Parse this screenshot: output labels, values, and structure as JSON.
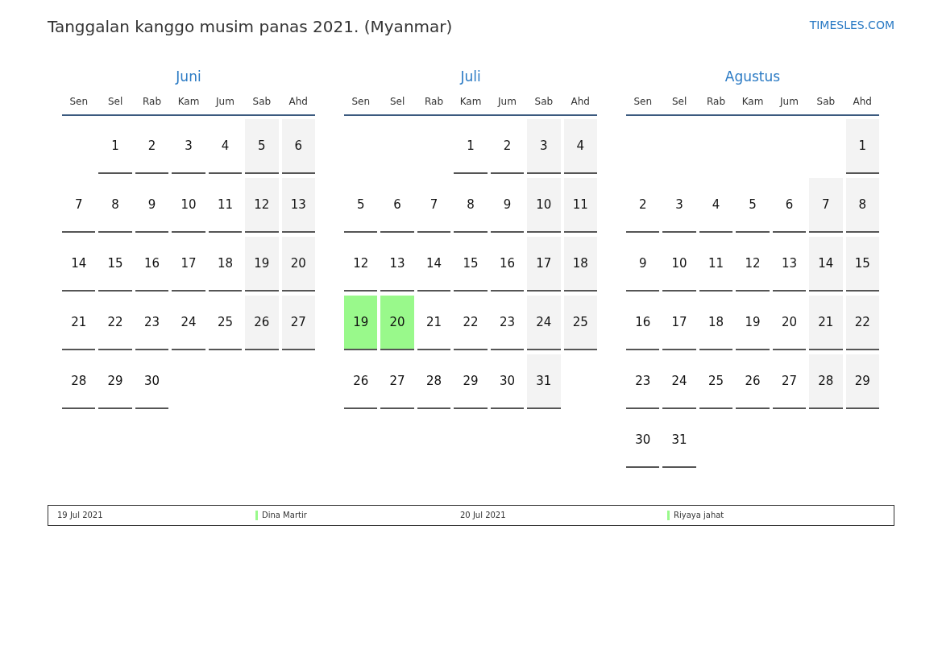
{
  "header": {
    "title": "Tanggalan kanggo musim panas 2021. (Myanmar)",
    "site_link": "TIMESLES.COM"
  },
  "months": [
    {
      "name": "Juni",
      "weekdays": [
        "Sen",
        "Sel",
        "Rab",
        "Kam",
        "Jum",
        "Sab",
        "Ahd"
      ],
      "days": [
        {
          "kind": "empty"
        },
        {
          "kind": "date",
          "day": "1",
          "weekend": false,
          "holiday": false
        },
        {
          "kind": "date",
          "day": "2",
          "weekend": false,
          "holiday": false
        },
        {
          "kind": "date",
          "day": "3",
          "weekend": false,
          "holiday": false
        },
        {
          "kind": "date",
          "day": "4",
          "weekend": false,
          "holiday": false
        },
        {
          "kind": "date",
          "day": "5",
          "weekend": true,
          "holiday": false
        },
        {
          "kind": "date",
          "day": "6",
          "weekend": true,
          "holiday": false
        },
        {
          "kind": "date",
          "day": "7",
          "weekend": false,
          "holiday": false
        },
        {
          "kind": "date",
          "day": "8",
          "weekend": false,
          "holiday": false
        },
        {
          "kind": "date",
          "day": "9",
          "weekend": false,
          "holiday": false
        },
        {
          "kind": "date",
          "day": "10",
          "weekend": false,
          "holiday": false
        },
        {
          "kind": "date",
          "day": "11",
          "weekend": false,
          "holiday": false
        },
        {
          "kind": "date",
          "day": "12",
          "weekend": true,
          "holiday": false
        },
        {
          "kind": "date",
          "day": "13",
          "weekend": true,
          "holiday": false
        },
        {
          "kind": "date",
          "day": "14",
          "weekend": false,
          "holiday": false
        },
        {
          "kind": "date",
          "day": "15",
          "weekend": false,
          "holiday": false
        },
        {
          "kind": "date",
          "day": "16",
          "weekend": false,
          "holiday": false
        },
        {
          "kind": "date",
          "day": "17",
          "weekend": false,
          "holiday": false
        },
        {
          "kind": "date",
          "day": "18",
          "weekend": false,
          "holiday": false
        },
        {
          "kind": "date",
          "day": "19",
          "weekend": true,
          "holiday": false
        },
        {
          "kind": "date",
          "day": "20",
          "weekend": true,
          "holiday": false
        },
        {
          "kind": "date",
          "day": "21",
          "weekend": false,
          "holiday": false
        },
        {
          "kind": "date",
          "day": "22",
          "weekend": false,
          "holiday": false
        },
        {
          "kind": "date",
          "day": "23",
          "weekend": false,
          "holiday": false
        },
        {
          "kind": "date",
          "day": "24",
          "weekend": false,
          "holiday": false
        },
        {
          "kind": "date",
          "day": "25",
          "weekend": false,
          "holiday": false
        },
        {
          "kind": "date",
          "day": "26",
          "weekend": true,
          "holiday": false
        },
        {
          "kind": "date",
          "day": "27",
          "weekend": true,
          "holiday": false
        },
        {
          "kind": "date",
          "day": "28",
          "weekend": false,
          "holiday": false
        },
        {
          "kind": "date",
          "day": "29",
          "weekend": false,
          "holiday": false
        },
        {
          "kind": "date",
          "day": "30",
          "weekend": false,
          "holiday": false
        }
      ]
    },
    {
      "name": "Juli",
      "weekdays": [
        "Sen",
        "Sel",
        "Rab",
        "Kam",
        "Jum",
        "Sab",
        "Ahd"
      ],
      "days": [
        {
          "kind": "empty"
        },
        {
          "kind": "empty"
        },
        {
          "kind": "empty"
        },
        {
          "kind": "date",
          "day": "1",
          "weekend": false,
          "holiday": false
        },
        {
          "kind": "date",
          "day": "2",
          "weekend": false,
          "holiday": false
        },
        {
          "kind": "date",
          "day": "3",
          "weekend": true,
          "holiday": false
        },
        {
          "kind": "date",
          "day": "4",
          "weekend": true,
          "holiday": false
        },
        {
          "kind": "date",
          "day": "5",
          "weekend": false,
          "holiday": false
        },
        {
          "kind": "date",
          "day": "6",
          "weekend": false,
          "holiday": false
        },
        {
          "kind": "date",
          "day": "7",
          "weekend": false,
          "holiday": false
        },
        {
          "kind": "date",
          "day": "8",
          "weekend": false,
          "holiday": false
        },
        {
          "kind": "date",
          "day": "9",
          "weekend": false,
          "holiday": false
        },
        {
          "kind": "date",
          "day": "10",
          "weekend": true,
          "holiday": false
        },
        {
          "kind": "date",
          "day": "11",
          "weekend": true,
          "holiday": false
        },
        {
          "kind": "date",
          "day": "12",
          "weekend": false,
          "holiday": false
        },
        {
          "kind": "date",
          "day": "13",
          "weekend": false,
          "holiday": false
        },
        {
          "kind": "date",
          "day": "14",
          "weekend": false,
          "holiday": false
        },
        {
          "kind": "date",
          "day": "15",
          "weekend": false,
          "holiday": false
        },
        {
          "kind": "date",
          "day": "16",
          "weekend": false,
          "holiday": false
        },
        {
          "kind": "date",
          "day": "17",
          "weekend": true,
          "holiday": false
        },
        {
          "kind": "date",
          "day": "18",
          "weekend": true,
          "holiday": false
        },
        {
          "kind": "date",
          "day": "19",
          "weekend": false,
          "holiday": true
        },
        {
          "kind": "date",
          "day": "20",
          "weekend": false,
          "holiday": true
        },
        {
          "kind": "date",
          "day": "21",
          "weekend": false,
          "holiday": false
        },
        {
          "kind": "date",
          "day": "22",
          "weekend": false,
          "holiday": false
        },
        {
          "kind": "date",
          "day": "23",
          "weekend": false,
          "holiday": false
        },
        {
          "kind": "date",
          "day": "24",
          "weekend": true,
          "holiday": false
        },
        {
          "kind": "date",
          "day": "25",
          "weekend": true,
          "holiday": false
        },
        {
          "kind": "date",
          "day": "26",
          "weekend": false,
          "holiday": false
        },
        {
          "kind": "date",
          "day": "27",
          "weekend": false,
          "holiday": false
        },
        {
          "kind": "date",
          "day": "28",
          "weekend": false,
          "holiday": false
        },
        {
          "kind": "date",
          "day": "29",
          "weekend": false,
          "holiday": false
        },
        {
          "kind": "date",
          "day": "30",
          "weekend": false,
          "holiday": false
        },
        {
          "kind": "date",
          "day": "31",
          "weekend": true,
          "holiday": false
        }
      ]
    },
    {
      "name": "Agustus",
      "weekdays": [
        "Sen",
        "Sel",
        "Rab",
        "Kam",
        "Jum",
        "Sab",
        "Ahd"
      ],
      "days": [
        {
          "kind": "empty"
        },
        {
          "kind": "empty"
        },
        {
          "kind": "empty"
        },
        {
          "kind": "empty"
        },
        {
          "kind": "empty"
        },
        {
          "kind": "empty"
        },
        {
          "kind": "date",
          "day": "1",
          "weekend": true,
          "holiday": false
        },
        {
          "kind": "date",
          "day": "2",
          "weekend": false,
          "holiday": false
        },
        {
          "kind": "date",
          "day": "3",
          "weekend": false,
          "holiday": false
        },
        {
          "kind": "date",
          "day": "4",
          "weekend": false,
          "holiday": false
        },
        {
          "kind": "date",
          "day": "5",
          "weekend": false,
          "holiday": false
        },
        {
          "kind": "date",
          "day": "6",
          "weekend": false,
          "holiday": false
        },
        {
          "kind": "date",
          "day": "7",
          "weekend": true,
          "holiday": false
        },
        {
          "kind": "date",
          "day": "8",
          "weekend": true,
          "holiday": false
        },
        {
          "kind": "date",
          "day": "9",
          "weekend": false,
          "holiday": false
        },
        {
          "kind": "date",
          "day": "10",
          "weekend": false,
          "holiday": false
        },
        {
          "kind": "date",
          "day": "11",
          "weekend": false,
          "holiday": false
        },
        {
          "kind": "date",
          "day": "12",
          "weekend": false,
          "holiday": false
        },
        {
          "kind": "date",
          "day": "13",
          "weekend": false,
          "holiday": false
        },
        {
          "kind": "date",
          "day": "14",
          "weekend": true,
          "holiday": false
        },
        {
          "kind": "date",
          "day": "15",
          "weekend": true,
          "holiday": false
        },
        {
          "kind": "date",
          "day": "16",
          "weekend": false,
          "holiday": false
        },
        {
          "kind": "date",
          "day": "17",
          "weekend": false,
          "holiday": false
        },
        {
          "kind": "date",
          "day": "18",
          "weekend": false,
          "holiday": false
        },
        {
          "kind": "date",
          "day": "19",
          "weekend": false,
          "holiday": false
        },
        {
          "kind": "date",
          "day": "20",
          "weekend": false,
          "holiday": false
        },
        {
          "kind": "date",
          "day": "21",
          "weekend": true,
          "holiday": false
        },
        {
          "kind": "date",
          "day": "22",
          "weekend": true,
          "holiday": false
        },
        {
          "kind": "date",
          "day": "23",
          "weekend": false,
          "holiday": false
        },
        {
          "kind": "date",
          "day": "24",
          "weekend": false,
          "holiday": false
        },
        {
          "kind": "date",
          "day": "25",
          "weekend": false,
          "holiday": false
        },
        {
          "kind": "date",
          "day": "26",
          "weekend": false,
          "holiday": false
        },
        {
          "kind": "date",
          "day": "27",
          "weekend": false,
          "holiday": false
        },
        {
          "kind": "date",
          "day": "28",
          "weekend": true,
          "holiday": false
        },
        {
          "kind": "date",
          "day": "29",
          "weekend": true,
          "holiday": false
        },
        {
          "kind": "date",
          "day": "30",
          "weekend": false,
          "holiday": false
        },
        {
          "kind": "date",
          "day": "31",
          "weekend": false,
          "holiday": false
        }
      ]
    }
  ],
  "legend": {
    "items": [
      {
        "date": "19 Jul 2021",
        "name": "Dina Martir",
        "color": "#99f98b"
      },
      {
        "date": "20 Jul 2021",
        "name": "Riyaya jahat",
        "color": "#99f98b"
      }
    ]
  }
}
